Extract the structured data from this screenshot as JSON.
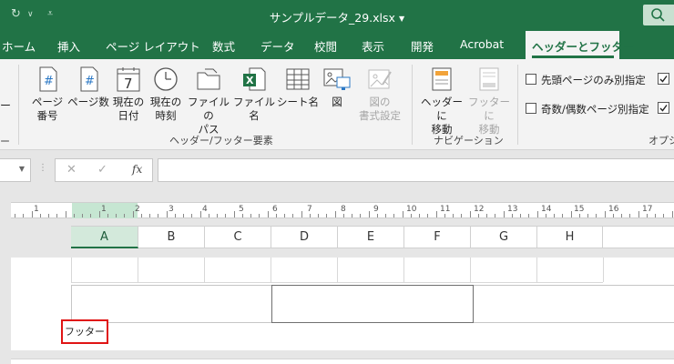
{
  "window": {
    "title": "サンプルデータ_29.xlsx"
  },
  "tabs": [
    {
      "label": "ホーム",
      "active": false
    },
    {
      "label": "挿入",
      "active": false
    },
    {
      "label": "ページ レイアウト",
      "active": false
    },
    {
      "label": "数式",
      "active": false
    },
    {
      "label": "データ",
      "active": false
    },
    {
      "label": "校閲",
      "active": false
    },
    {
      "label": "表示",
      "active": false
    },
    {
      "label": "開発",
      "active": false
    },
    {
      "label": "Acrobat",
      "active": false
    },
    {
      "label": "ヘッダーとフッター",
      "active": true
    }
  ],
  "ribbon": {
    "partial_left": "ー",
    "header_footer_elements": {
      "label": "ヘッダー/フッター要素",
      "buttons": [
        {
          "line1": "ページ",
          "line2": "番号",
          "icon": "page-number-icon"
        },
        {
          "line1": "ページ数",
          "line2": "",
          "icon": "page-count-icon"
        },
        {
          "line1": "現在の",
          "line2": "日付",
          "icon": "calendar-icon"
        },
        {
          "line1": "現在の",
          "line2": "時刻",
          "icon": "clock-icon"
        },
        {
          "line1": "ファイルの",
          "line2": "パス",
          "icon": "folder-icon"
        },
        {
          "line1": "ファイル名",
          "line2": "",
          "icon": "excel-file-icon"
        },
        {
          "line1": "シート名",
          "line2": "",
          "icon": "sheet-icon"
        },
        {
          "line1": "図",
          "line2": "",
          "icon": "picture-icon"
        },
        {
          "line1": "図の",
          "line2": "書式設定",
          "icon": "format-picture-icon",
          "disabled": true
        }
      ]
    },
    "navigation": {
      "label": "ナビゲーション",
      "buttons": [
        {
          "line1": "ヘッダーに",
          "line2": "移動",
          "icon": "goto-header-icon"
        },
        {
          "line1": "フッターに",
          "line2": "移動",
          "icon": "goto-footer-icon",
          "disabled": true
        }
      ]
    },
    "options": {
      "label": "オプシ",
      "checkboxes": [
        {
          "label": "先頭ページのみ別指定",
          "checked": false
        },
        {
          "label": "奇数/偶数ページ別指定",
          "checked": false
        }
      ]
    }
  },
  "formula_bar": {
    "fx": "fx",
    "value": ""
  },
  "ruler": {
    "numbers": [
      "1",
      "1",
      "2",
      "3",
      "4",
      "5",
      "6",
      "7",
      "8",
      "9",
      "10",
      "11",
      "12",
      "13",
      "14",
      "15",
      "16",
      "17"
    ]
  },
  "columns": [
    "A",
    "B",
    "C",
    "D",
    "E",
    "F",
    "G",
    "H"
  ],
  "selected_column": "A",
  "footer": {
    "label": "フッター"
  },
  "colors": {
    "accent": "#217346",
    "highlight_border": "#e01414"
  }
}
